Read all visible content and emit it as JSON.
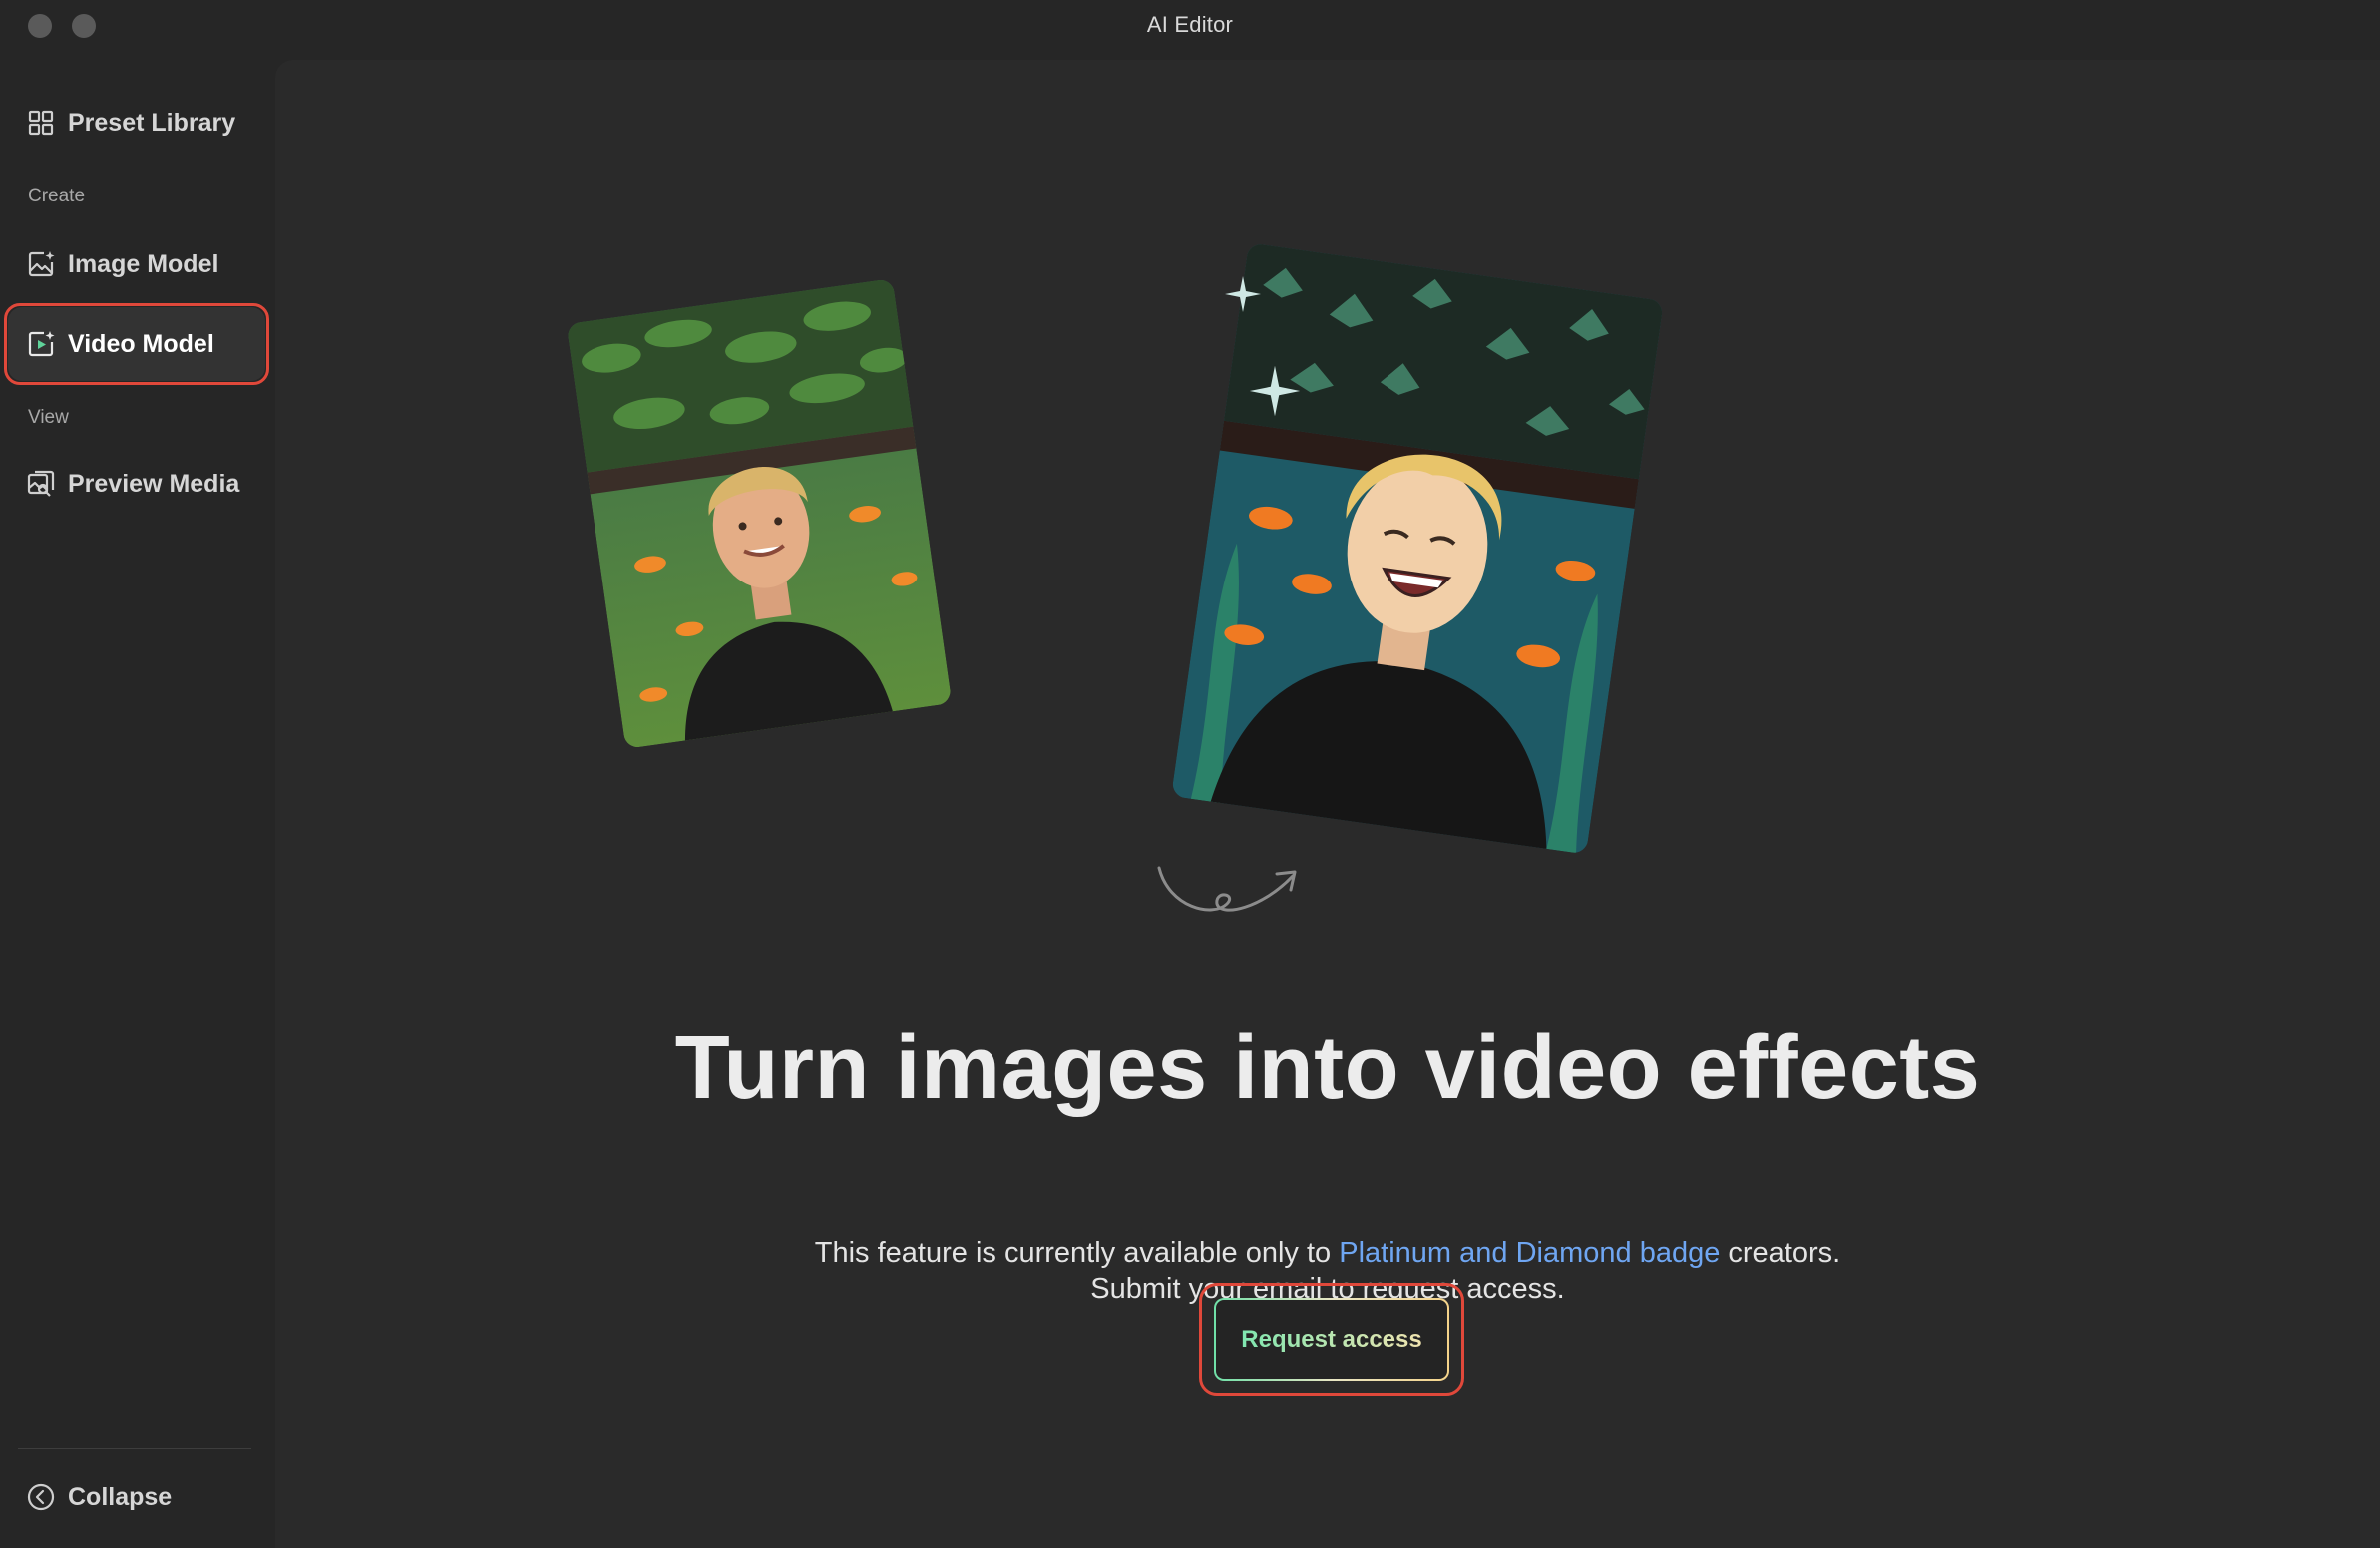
{
  "window": {
    "title": "AI Editor"
  },
  "sidebar": {
    "top_item": {
      "label": "Preset Library",
      "icon": "grid-icon"
    },
    "sections": [
      {
        "label": "Create",
        "items": [
          {
            "label": "Image Model",
            "icon": "image-sparkle-icon"
          },
          {
            "label": "Video Model",
            "icon": "video-sparkle-icon",
            "active": true
          }
        ]
      },
      {
        "label": "View",
        "items": [
          {
            "label": "Preview Media",
            "icon": "preview-media-icon"
          }
        ]
      }
    ],
    "collapse_label": "Collapse"
  },
  "main": {
    "headline": "Turn images into video effects",
    "subtext": {
      "line1_before": "This feature is currently available only to ",
      "line1_link": "Platinum and Diamond badge",
      "line1_after": " creators.",
      "line2": "Submit your email to request access."
    },
    "cta_label": "Request access"
  },
  "colors": {
    "background": "#262626",
    "panel": "#2a2a2a",
    "link": "#6fa6f2",
    "highlight": "#e0483a",
    "cta_gradient_start": "#6fe0a8",
    "cta_gradient_end": "#f4d38a"
  }
}
